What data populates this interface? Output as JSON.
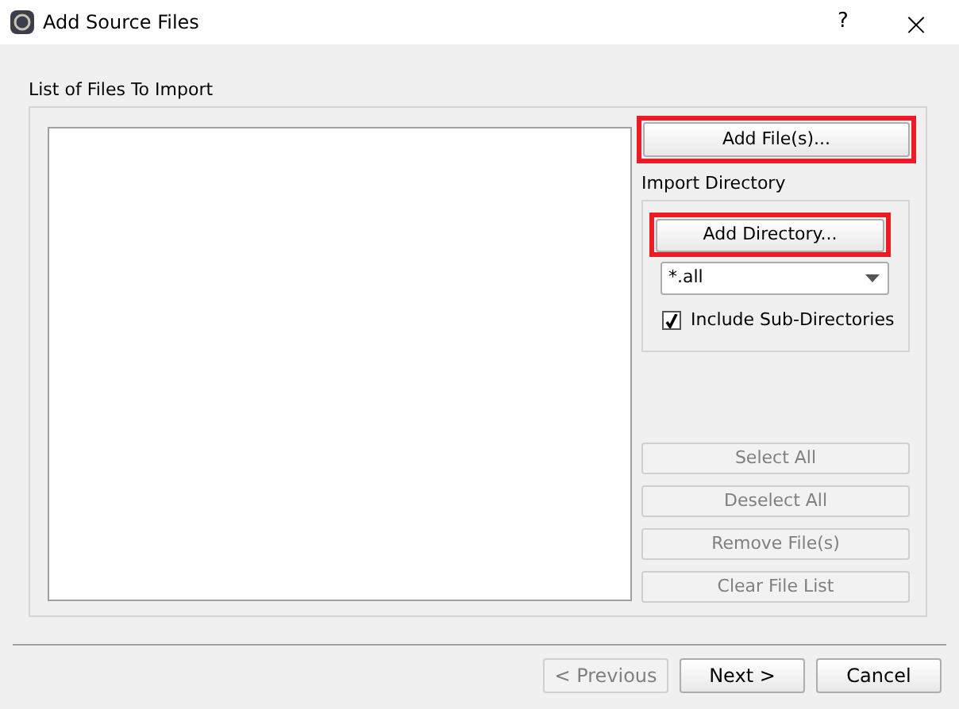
{
  "window": {
    "title": "Add Source Files",
    "help": "?",
    "close": "×"
  },
  "files_group": {
    "label": "List of Files To Import"
  },
  "add_files_button": {
    "label": "Add File(s)...",
    "highlighted": true
  },
  "import_directory": {
    "label": "Import Directory",
    "add_directory_button": {
      "label": "Add Directory...",
      "highlighted": true
    },
    "filter": {
      "value": "*.all"
    },
    "include_subdirectories": {
      "label": "Include Sub-Directories",
      "checked": true
    }
  },
  "list_buttons": [
    {
      "label": "Select All",
      "disabled": true
    },
    {
      "label": "Deselect All",
      "disabled": true
    },
    {
      "label": "Remove File(s)",
      "disabled": true
    },
    {
      "label": "Clear File List",
      "disabled": true
    }
  ],
  "footer_buttons": [
    {
      "label": "< Previous",
      "disabled": true
    },
    {
      "label": "Next >",
      "disabled": false
    },
    {
      "label": "Cancel",
      "disabled": false
    }
  ]
}
